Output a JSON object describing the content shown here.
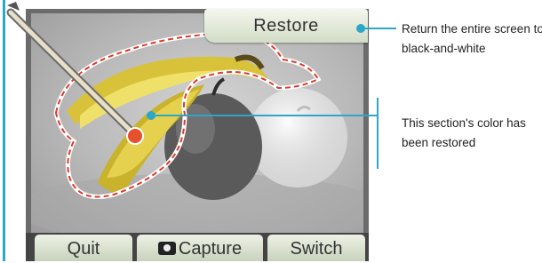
{
  "restore_button": "Restore",
  "bottom_bar": {
    "quit": "Quit",
    "capture": "Capture",
    "switch": "Switch"
  },
  "callouts": [
    "Return the entire screen to black-and-white",
    "This section's color has been restored"
  ],
  "colors": {
    "accent": "#2aa7c9",
    "highlight_outline": "#d93a2b",
    "button_face": "#e2e8d8"
  }
}
